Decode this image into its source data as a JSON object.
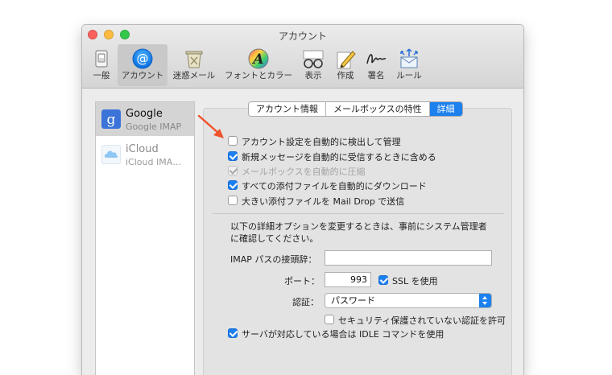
{
  "window": {
    "title": "アカウント"
  },
  "toolbar": {
    "items": [
      {
        "label": "一般",
        "icon": "switch-icon"
      },
      {
        "label": "アカウント",
        "icon": "at-icon",
        "selected": true
      },
      {
        "label": "迷惑メール",
        "icon": "junk-trash-icon"
      },
      {
        "label": "フォントとカラー",
        "icon": "font-icon"
      },
      {
        "label": "表示",
        "icon": "glasses-icon"
      },
      {
        "label": "作成",
        "icon": "pencil-icon"
      },
      {
        "label": "署名",
        "icon": "signature-icon"
      },
      {
        "label": "ルール",
        "icon": "rules-icon"
      }
    ]
  },
  "sidebar": {
    "accounts": [
      {
        "name": "Google",
        "type": "Google IMAP",
        "icon": "google-icon",
        "selected": true
      },
      {
        "name": "iCloud",
        "type": "iCloud IMA…",
        "icon": "icloud-icon",
        "selected": false
      }
    ]
  },
  "tabs": [
    {
      "label": "アカウント情報"
    },
    {
      "label": "メールボックスの特性"
    },
    {
      "label": "詳細",
      "active": true
    }
  ],
  "options": [
    {
      "label": "アカウント設定を自動的に検出して管理",
      "checked": false,
      "enabled": true
    },
    {
      "label": "新規メッセージを自動的に受信するときに含める",
      "checked": true,
      "enabled": true
    },
    {
      "label": "メールボックスを自動的に圧縮",
      "checked": true,
      "enabled": false
    },
    {
      "label": "すべての添付ファイルを自動的にダウンロード",
      "checked": true,
      "enabled": true
    },
    {
      "label": "大きい添付ファイルを Mail Drop で送信",
      "checked": false,
      "enabled": true
    }
  ],
  "advanced": {
    "notice_line1": "以下の詳細オプションを変更するときは、事前にシステム管理者",
    "notice_line2": "に確認してください。",
    "imap_prefix_label": "IMAP パスの接頭辞：",
    "imap_prefix_value": "",
    "port_label": "ポート：",
    "port_value": "993",
    "ssl_label": "SSL を使用",
    "ssl_checked": true,
    "auth_label": "認証：",
    "auth_value": "パスワード",
    "insecure_auth_label": "セキュリティ保護されていない認証を許可",
    "insecure_auth_checked": false,
    "idle_label": "サーバが対応している場合は IDLE コマンドを使用",
    "idle_checked": true
  },
  "colors": {
    "accent": "#1c80ee",
    "annotation_arrow": "#f0522c"
  }
}
